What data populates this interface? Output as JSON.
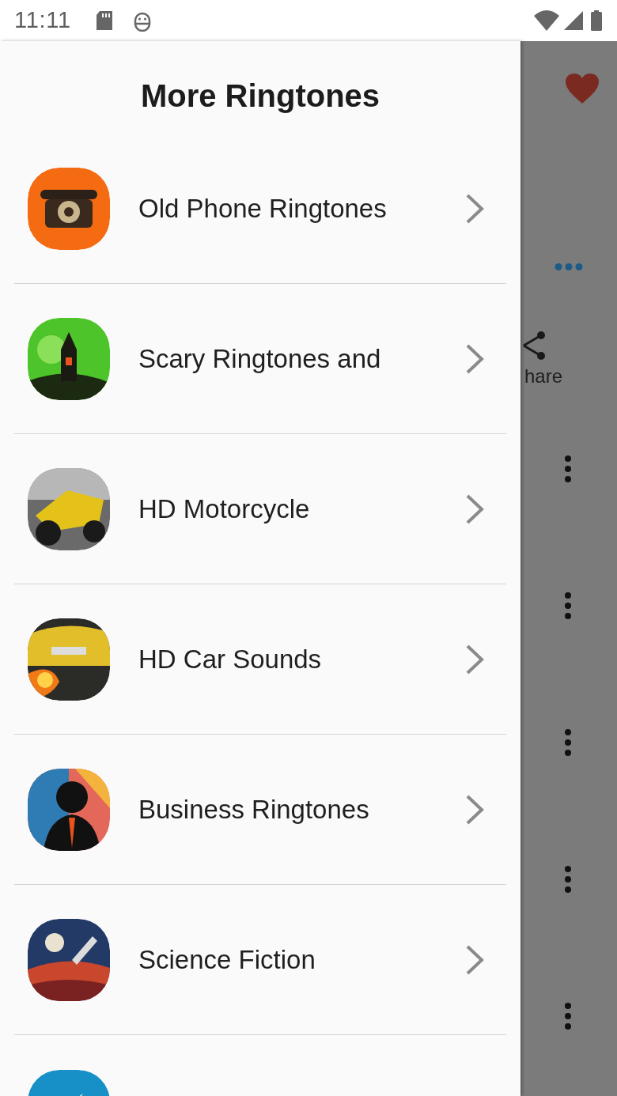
{
  "status_bar": {
    "time": "11:11"
  },
  "drawer": {
    "title": "More Ringtones",
    "items": [
      {
        "label": "Old Phone Ringtones",
        "kind": "picture"
      },
      {
        "label": "Scary Ringtones and",
        "kind": "picture"
      },
      {
        "label": "HD Motorcycle",
        "kind": "picture"
      },
      {
        "label": "HD Car Sounds",
        "kind": "picture"
      },
      {
        "label": "Business Ringtones",
        "kind": "picture"
      },
      {
        "label": "Science Fiction",
        "kind": "picture"
      },
      {
        "kind": "picture"
      }
    ]
  },
  "background_screen": {
    "share_label": "hare"
  }
}
